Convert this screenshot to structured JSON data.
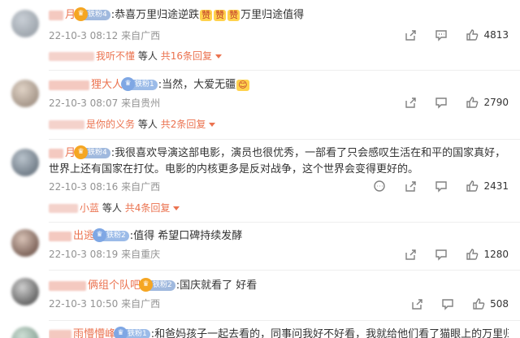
{
  "comments": [
    {
      "user_visible": "月",
      "fan_badge": "铁粉4",
      "text_prefix": ":恭喜万里归途逆跌",
      "text_suffix": "万里归途值得",
      "emojis": [
        "赞",
        "赞",
        "赞"
      ],
      "date": "22-10-3 08:12",
      "location": "来自广西",
      "likes": "4813",
      "reply_user": "我听不懂",
      "reply_mid": "等人",
      "reply_more": "共16条回复"
    },
    {
      "user_visible": "狸大人",
      "fan_badge": "铁粉1",
      "text": ":当然，大爱无疆",
      "emoji": "😊",
      "date": "22-10-3 08:07",
      "location": "来自贵州",
      "likes": "2790",
      "reply_user": "是你的义务",
      "reply_mid": "等人",
      "reply_more": "共2条回复"
    },
    {
      "user_visible": "月",
      "fan_badge": "铁粉4",
      "text": ":我很喜欢导演这部电影，演员也很优秀，一部看了只会感叹生活在和平的国家真好，世界上还有国家在打仗。电影的内核更多是反对战争，这个世界会变得更好的。",
      "date": "22-10-3 08:16",
      "location": "来自广西",
      "likes": "2431",
      "reply_user": "小蓝",
      "reply_mid": "等人",
      "reply_more": "共4条回复"
    },
    {
      "user_visible": "出逃",
      "fan_badge": "铁粉2",
      "text": ":值得 希望口碑持续发酵",
      "date": "22-10-3 08:19",
      "location": "来自重庆",
      "likes": "1280"
    },
    {
      "user_visible": "俩组个队吧",
      "fan_badge": "铁粉2",
      "text": ":国庆就看了 好看",
      "date": "22-10-3 10:50",
      "location": "来自广西",
      "likes": "508"
    },
    {
      "user_visible": "雨懵懵峰",
      "fan_badge": "铁粉1",
      "text": ":和爸妈孩子一起去看的，同事问我好不好看，我就给他们看了猫眼上的万里归途"
    }
  ]
}
